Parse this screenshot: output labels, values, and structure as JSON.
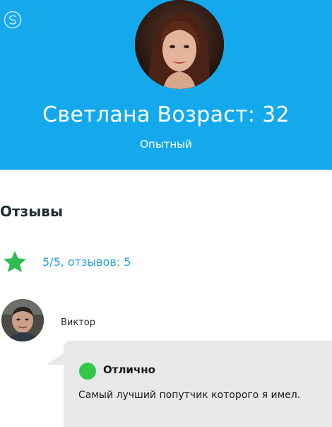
{
  "profile": {
    "name_age": "Светлана Возраст: 32",
    "level": "Опытный",
    "avatar_icon": "woman-portrait-photo"
  },
  "reviews": {
    "title": "Отзывы",
    "rating_summary": "5/5, отзывов: 5",
    "star_icon": "star-icon",
    "star_color": "#2ebd4f",
    "items": [
      {
        "author": "Виктор",
        "avatar_icon": "man-portrait-photo",
        "status_label": "Отлично",
        "status_color": "#32c748",
        "text": "Самый лучший попутчик которого я имел."
      }
    ]
  },
  "colors": {
    "header_bg": "#14a9ec",
    "accent_text": "#27a3d8",
    "bubble_bg": "#e7e8e8"
  }
}
